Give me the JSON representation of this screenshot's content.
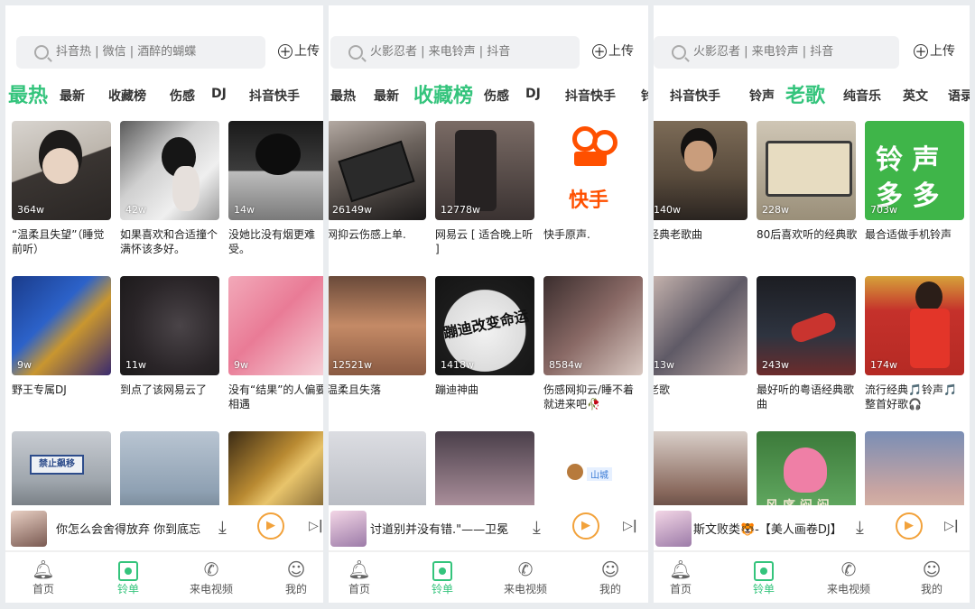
{
  "search": {
    "panel1_placeholder": "抖音热 | 微信 | 酒醉的蝴蝶",
    "panel2_placeholder": "火影忍者 | 来电铃声 | 抖音",
    "panel3_placeholder": "火影忍者 | 来电铃声 | 抖音"
  },
  "upload_label": "上传",
  "tabs": {
    "panel1": [
      "最热",
      "最新",
      "收藏榜",
      "伤感",
      "DJ",
      "抖音快手"
    ],
    "panel2": [
      "最热",
      "最新",
      "收藏榜",
      "伤感",
      "DJ",
      "抖音快手",
      "铃"
    ],
    "panel3": [
      "抖音快手",
      "铃声",
      "老歌",
      "纯音乐",
      "英文",
      "语录"
    ]
  },
  "cards": {
    "panel1": [
      {
        "count": "364w",
        "caption": "“温柔且失望”（睡觉前听）"
      },
      {
        "count": "42w",
        "caption": "如果喜欢和合适撞个满怀该多好。"
      },
      {
        "count": "14w",
        "caption": "没她比没有烟更难受。"
      },
      {
        "count": "9w",
        "caption": "野王专属DJ"
      },
      {
        "count": "11w",
        "caption": "到点了该网易云了"
      },
      {
        "count": "9w",
        "caption": "没有“结果”的人偏要相遇"
      },
      {
        "count": "",
        "caption": ""
      },
      {
        "count": "",
        "caption": ""
      },
      {
        "count": "",
        "caption": ""
      }
    ],
    "panel2": [
      {
        "count": "26149w",
        "caption": "网抑云伤感上单."
      },
      {
        "count": "12778w",
        "caption": "网易云 [ 适合晚上听 ]"
      },
      {
        "count": "",
        "caption": "快手原声."
      },
      {
        "count": "12521w",
        "caption": "温柔且失落"
      },
      {
        "count": "1418w",
        "caption": "蹦迪神曲"
      },
      {
        "count": "8584w",
        "caption": "伤感网抑云/睡不着就进来吧🥀"
      },
      {
        "count": "",
        "caption": ""
      },
      {
        "count": "",
        "caption": ""
      },
      {
        "count": "",
        "caption": ""
      }
    ],
    "panel3": [
      {
        "count": "140w",
        "caption": "经典老歌曲"
      },
      {
        "count": "228w",
        "caption": "80后喜欢听的经典歌"
      },
      {
        "count": "703w",
        "caption": "最合适做手机铃声"
      },
      {
        "count": "13w",
        "caption": "老歌"
      },
      {
        "count": "243w",
        "caption": "最好听的粤语经典歌曲"
      },
      {
        "count": "174w",
        "caption": "流行经典🎵铃声🎵整首好歌🎧"
      },
      {
        "count": "",
        "caption": ""
      },
      {
        "count": "",
        "caption": ""
      },
      {
        "count": "",
        "caption": ""
      }
    ]
  },
  "thumb_text": {
    "kuaishou": "快手",
    "lingsheng_top": "铃 声",
    "lingsheng_bottom": "多 多",
    "sign": "禁止飙移",
    "fan": "蹦迪改变命运",
    "tag": "山城",
    "lotus": "风 序 闷 闷"
  },
  "player": {
    "panel1_title": "你怎么会舍得放弃 你到底忘",
    "panel2_title": "讨道别并没有错.\"——卫冕",
    "panel3_title": "斯文败类🐯-【美人画卷DJ】"
  },
  "nav": [
    {
      "label": "首页",
      "icon": "bell-icon"
    },
    {
      "label": "铃单",
      "icon": "playlist-icon"
    },
    {
      "label": "来电视频",
      "icon": "phone-icon"
    },
    {
      "label": "我的",
      "icon": "profile-icon"
    }
  ],
  "colors": {
    "accent": "#34c47c",
    "play": "#f2a23b"
  }
}
